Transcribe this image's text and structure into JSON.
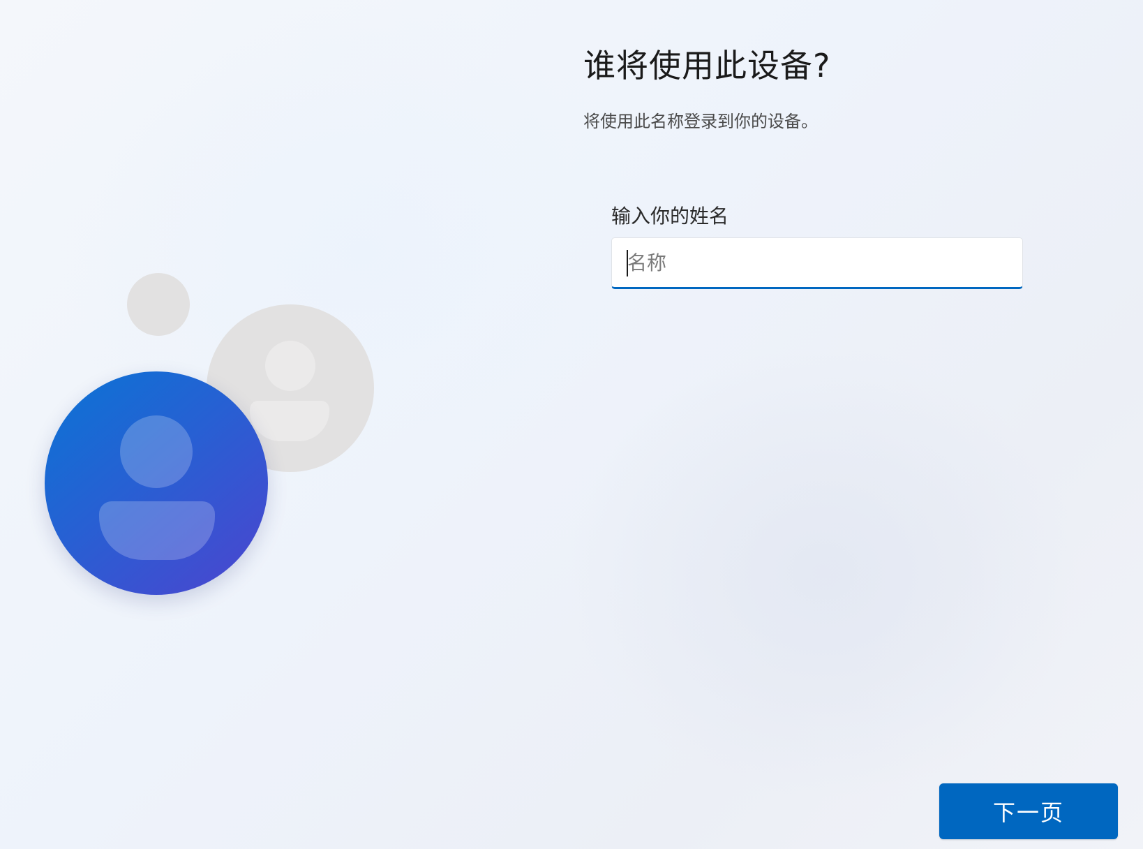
{
  "page": {
    "title": "谁将使用此设备?",
    "subtitle": "将使用此名称登录到你的设备。"
  },
  "form": {
    "label": "输入你的姓名",
    "name_input": {
      "value": "",
      "placeholder": "名称"
    }
  },
  "footer": {
    "next_label": "下一页"
  },
  "illustration": {
    "name": "people-avatars-illustration",
    "colors": {
      "primary_avatar_start": "#0a74d4",
      "primary_avatar_end": "#4d44cf",
      "secondary_avatar": "#e2e1e1"
    }
  },
  "colors": {
    "accent": "#0067c0",
    "text_primary": "#1a1a1a",
    "text_secondary": "#4a4a4a"
  }
}
